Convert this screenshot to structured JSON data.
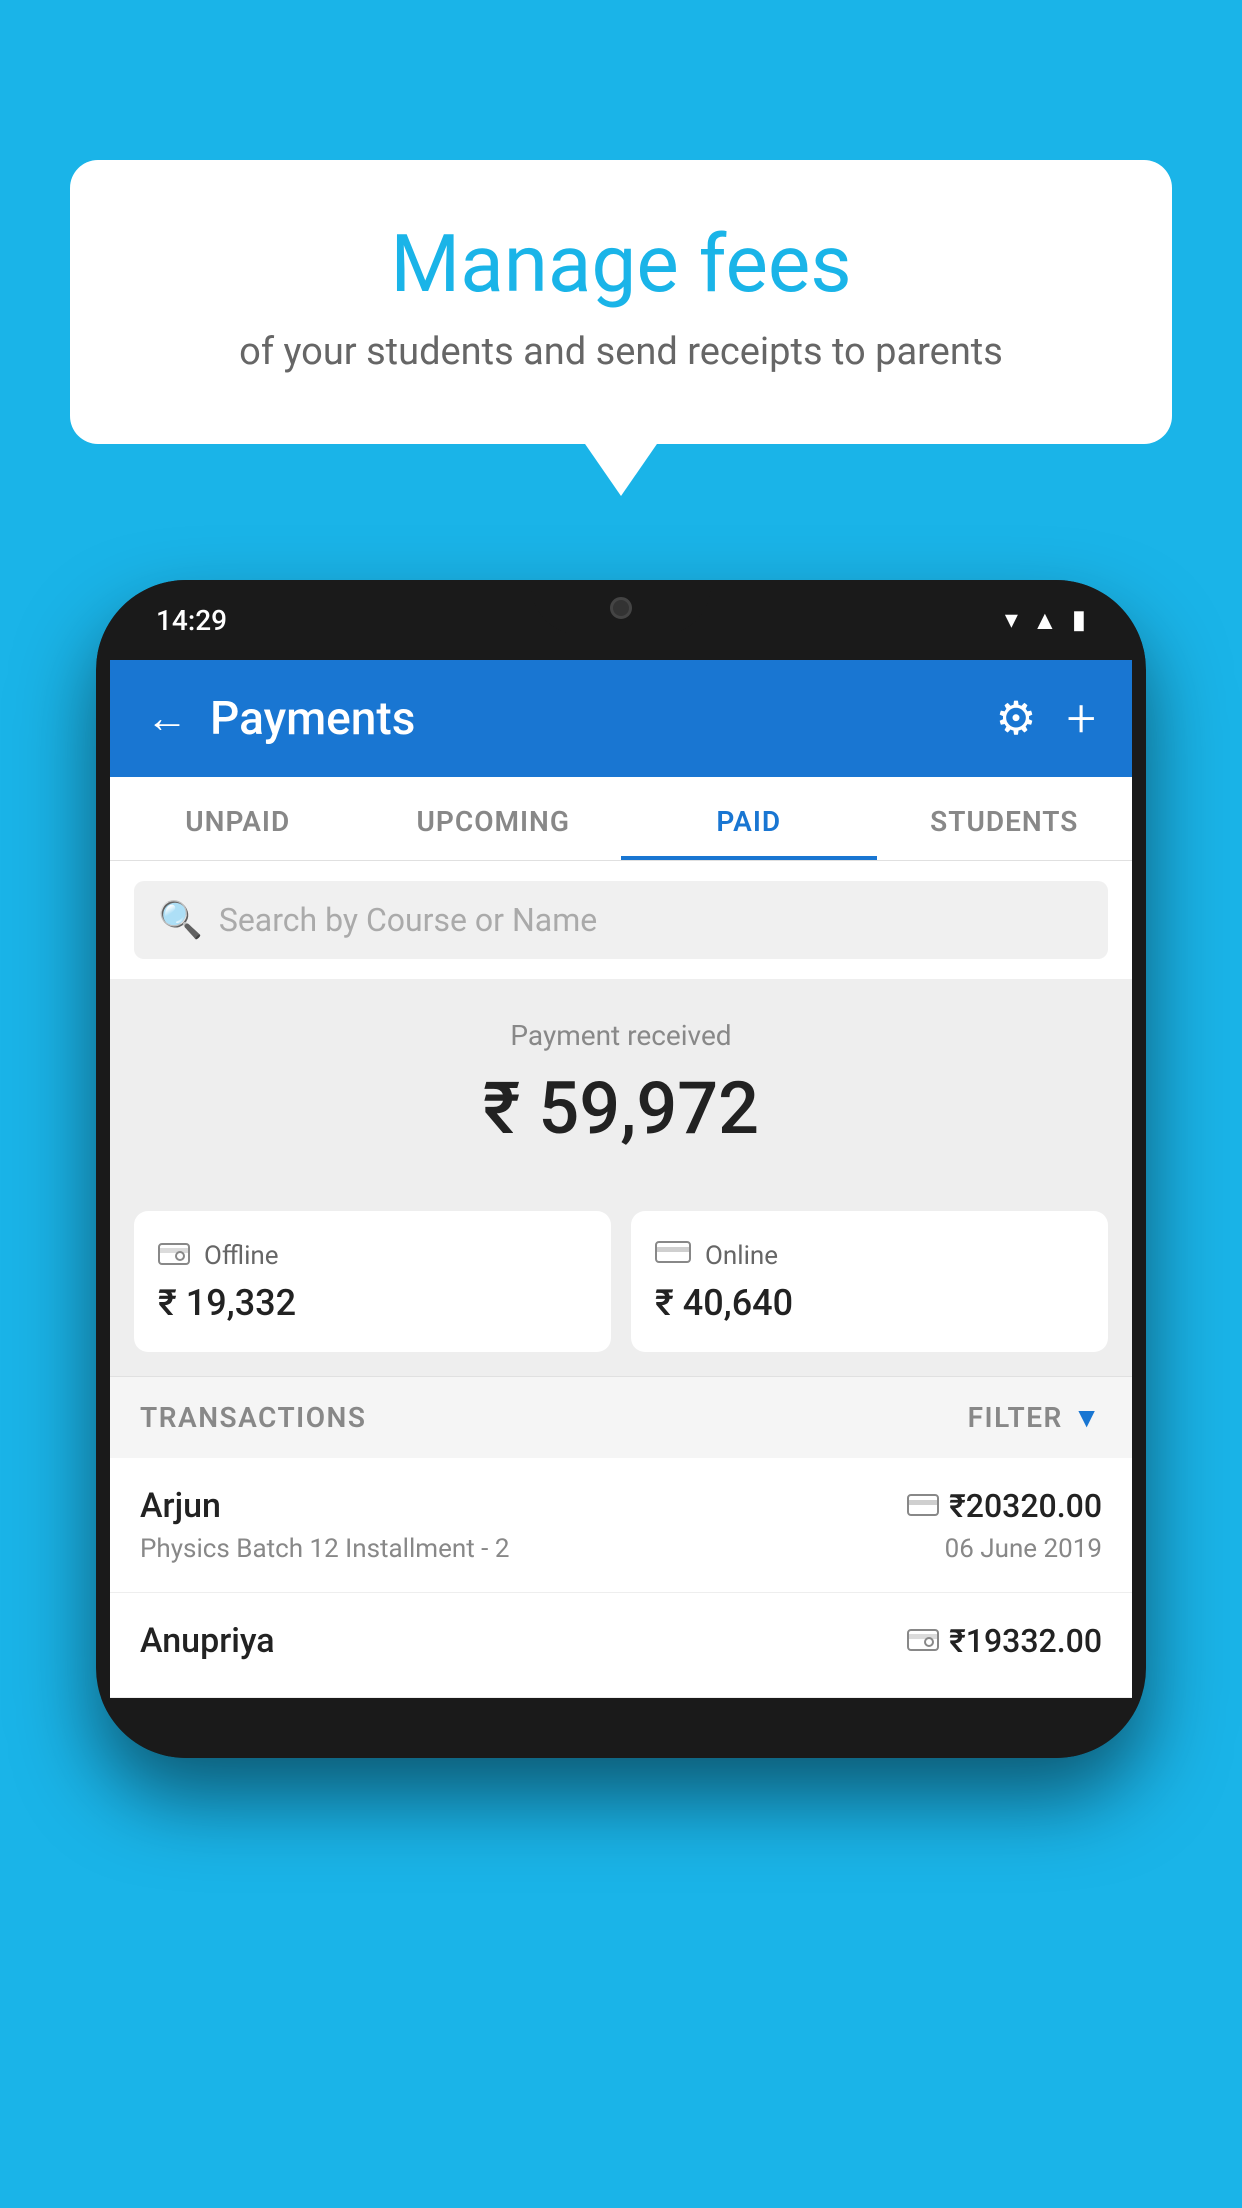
{
  "background_color": "#1ab4e8",
  "bubble": {
    "title": "Manage fees",
    "subtitle": "of your students and send receipts to parents"
  },
  "status_bar": {
    "time": "14:29",
    "icons": [
      "wifi",
      "signal",
      "battery"
    ]
  },
  "app_header": {
    "title": "Payments",
    "back_label": "←",
    "settings_label": "⚙",
    "add_label": "+"
  },
  "tabs": [
    {
      "label": "UNPAID",
      "active": false
    },
    {
      "label": "UPCOMING",
      "active": false
    },
    {
      "label": "PAID",
      "active": true
    },
    {
      "label": "STUDENTS",
      "active": false
    }
  ],
  "search": {
    "placeholder": "Search by Course or Name"
  },
  "payment": {
    "received_label": "Payment received",
    "total_amount": "₹ 59,972",
    "offline_label": "Offline",
    "offline_amount": "₹ 19,332",
    "online_label": "Online",
    "online_amount": "₹ 40,640"
  },
  "transactions_header": {
    "label": "TRANSACTIONS",
    "filter_label": "FILTER"
  },
  "transactions": [
    {
      "name": "Arjun",
      "amount": "₹20320.00",
      "detail": "Physics Batch 12 Installment - 2",
      "date": "06 June 2019",
      "payment_type": "card"
    },
    {
      "name": "Anupriya",
      "amount": "₹19332.00",
      "detail": "",
      "date": "",
      "payment_type": "cash"
    }
  ]
}
